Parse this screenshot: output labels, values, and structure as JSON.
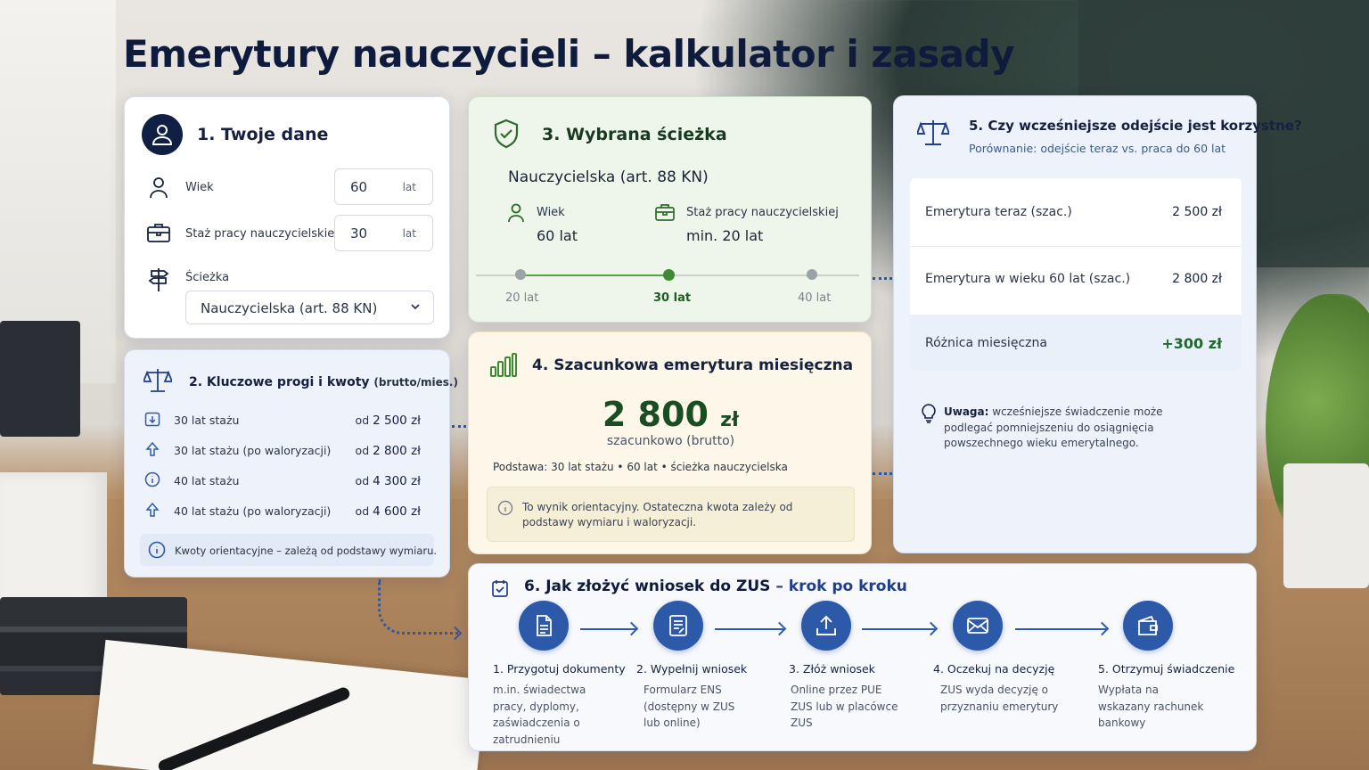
{
  "title": "Emerytury nauczycieli – kalkulator i zasady",
  "card1": {
    "title": "1. Twoje dane",
    "age_label": "Wiek",
    "age_value": "60",
    "age_unit": "lat",
    "tenure_label": "Staż pracy nauczycielskiej",
    "tenure_value": "30",
    "tenure_unit": "lat",
    "path_label": "Ścieżka",
    "path_value": "Nauczycielska (art. 88 KN)"
  },
  "card2": {
    "title": "2. Kluczowe progi i kwoty",
    "title_suffix": "(brutto/mies.)",
    "rows": [
      {
        "label": "30 lat stażu",
        "prefix": "od",
        "value": "2 500 zł"
      },
      {
        "label": "30 lat stażu (po waloryzacji)",
        "prefix": "od",
        "value": "2 800 zł"
      },
      {
        "label": "40 lat stażu",
        "prefix": "od",
        "value": "4 300 zł"
      },
      {
        "label": "40 lat stażu (po waloryzacji)",
        "prefix": "od",
        "value": "4 600 zł"
      }
    ],
    "note": "Kwoty orientacyjne – zależą od podstawy wymiaru."
  },
  "card3": {
    "title": "3. Wybrana ścieżka",
    "path": "Nauczycielska (art. 88 KN)",
    "age_label": "Wiek",
    "age_value": "60 lat",
    "tenure_label": "Staż pracy nauczycielskiej",
    "tenure_value": "min. 20 lat",
    "scale": [
      "20 lat",
      "30 lat",
      "40 lat"
    ],
    "selected_index": 1
  },
  "card4": {
    "title": "4. Szacunkowa emerytura miesięczna",
    "amount": "2 800",
    "currency": "zł",
    "amount_sub": "szacunkowo (brutto)",
    "basis": "Podstawa: 30 lat stażu • 60 lat • ścieżka nauczycielska",
    "info": "To wynik orientacyjny. Ostateczna kwota zależy od podstawy wymiaru i waloryzacji."
  },
  "card5": {
    "title": "5. Czy wcześniejsze odejście jest korzystne?",
    "subtitle": "Porównanie: odejście teraz vs. praca do 60 lat",
    "rows": [
      {
        "label": "Emerytura teraz (szac.)",
        "value": "2 500 zł"
      },
      {
        "label": "Emerytura w wieku 60 lat (szac.)",
        "value": "2 800 zł"
      },
      {
        "label": "Różnica miesięczna",
        "value": "+300 zł"
      }
    ],
    "warning_bold": "Uwaga:",
    "warning": "wcześniejsze świadczenie może podlegać pomniejszeniu do osiągnięcia powszechnego wieku emerytalnego."
  },
  "card6": {
    "title": "6. Jak złożyć wniosek do ZUS",
    "title_suffix": "– krok po kroku",
    "steps": [
      {
        "title": "1. Przygotuj dokumenty",
        "desc": "m.in. świadectwa pracy, dyplomy, zaświadczenia o zatrudnieniu",
        "icon": "document-icon"
      },
      {
        "title": "2. Wypełnij wniosek",
        "desc": "Formularz ENS (dostępny w ZUS lub online)",
        "icon": "form-icon"
      },
      {
        "title": "3. Złóż wniosek",
        "desc": "Online przez PUE ZUS lub w placówce ZUS",
        "icon": "upload-icon"
      },
      {
        "title": "4. Oczekuj na decyzję",
        "desc": "ZUS wyda decyzję o przyznaniu emerytury",
        "icon": "envelope-icon"
      },
      {
        "title": "5. Otrzymuj świadczenie",
        "desc": "Wypłata na wskazany rachunek bankowy",
        "icon": "wallet-icon"
      }
    ]
  },
  "colors": {
    "navy": "#0f1b3d",
    "accent_blue": "#2d5aa8",
    "green": "#3e8a33",
    "positive": "#1e6a2a"
  }
}
